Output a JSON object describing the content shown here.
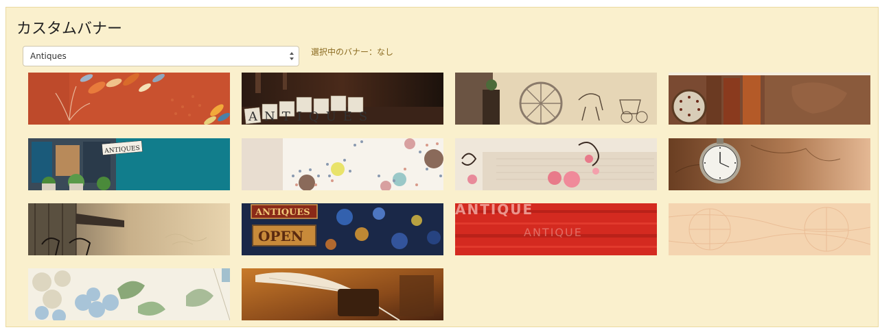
{
  "page": {
    "title": "カスタムバナー",
    "status": "選択中のバナー：なし"
  },
  "category_select": {
    "value": "Antiques"
  },
  "banners": {
    "b1": {
      "description": "Rust orange with fern and leaves"
    },
    "b2": {
      "text": "ANTIQUES"
    },
    "b3": {
      "description": "Wagon wheel and horse carriage sketch"
    },
    "b4": {
      "description": "Old books and pocket watch"
    },
    "b5": {
      "text": "ANTIQUES"
    },
    "b6": {
      "description": "Dandelion dots on white"
    },
    "b7": {
      "description": "Pink roses on script paper"
    },
    "b8": {
      "description": "Pocket watch on old map"
    },
    "b9": {
      "description": "Porch with rocking chairs"
    },
    "b10": {
      "text_top": "ANTIQUES",
      "text_bottom": "OPEN"
    },
    "b11": {
      "text": "ANTIQUE"
    },
    "b12": {
      "description": "Faded antique map"
    },
    "b13": {
      "description": "Blue hydrangea on cream"
    },
    "b14": {
      "description": "Quill pen and inkwell"
    }
  },
  "colors": {
    "panel_bg": "#faf0cd",
    "status_text": "#8a6a1f"
  }
}
